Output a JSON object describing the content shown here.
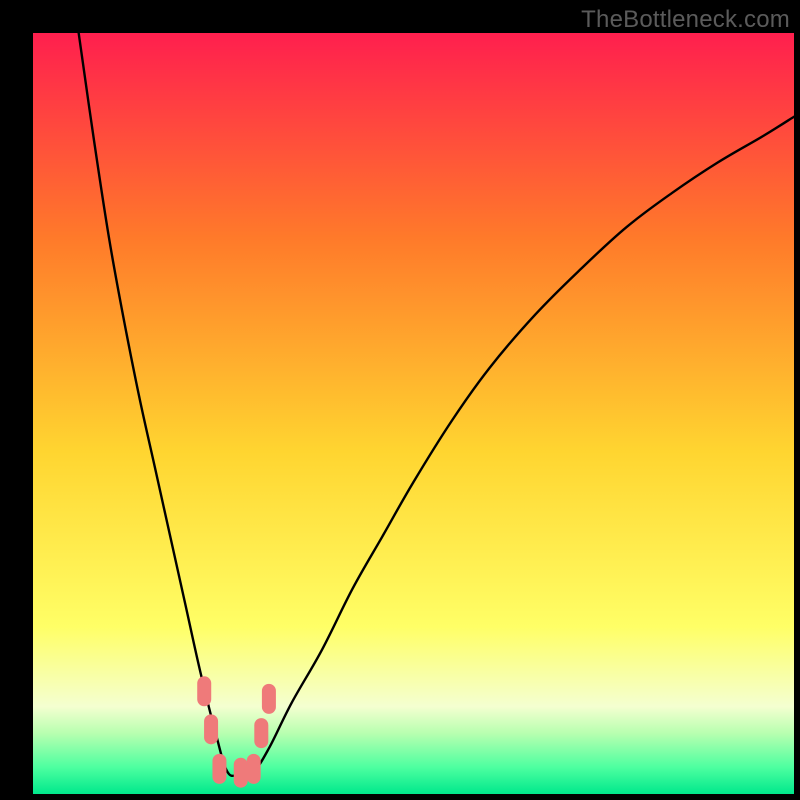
{
  "watermark": "TheBottleneck.com",
  "chart_data": {
    "type": "line",
    "title": "",
    "xlabel": "",
    "ylabel": "",
    "xlim": [
      0,
      100
    ],
    "ylim": [
      0,
      100
    ],
    "background": {
      "gradient_stops": [
        {
          "offset": 0.0,
          "color": "#ff1f4e"
        },
        {
          "offset": 0.27,
          "color": "#ff7a2a"
        },
        {
          "offset": 0.55,
          "color": "#ffd530"
        },
        {
          "offset": 0.78,
          "color": "#ffff66"
        },
        {
          "offset": 0.885,
          "color": "#f4ffd0"
        },
        {
          "offset": 0.92,
          "color": "#b8ffb0"
        },
        {
          "offset": 0.965,
          "color": "#4dffa0"
        },
        {
          "offset": 1.0,
          "color": "#00e88c"
        }
      ]
    },
    "series": [
      {
        "name": "bottleneck-curve",
        "x": [
          6,
          8,
          10,
          12,
          14,
          16,
          18,
          20,
          22,
          24,
          25.5,
          27,
          29,
          31,
          34,
          38,
          42,
          46,
          50,
          55,
          60,
          66,
          72,
          78,
          84,
          90,
          96,
          100
        ],
        "y": [
          100,
          86,
          73,
          62,
          52,
          43,
          34,
          25,
          16,
          8,
          3,
          2.5,
          3,
          6,
          12,
          19,
          27,
          34,
          41,
          49,
          56,
          63,
          69,
          74.5,
          79,
          83,
          86.5,
          89
        ]
      }
    ],
    "markers": {
      "name": "highlight-dots",
      "color": "#ef7a7a",
      "points": [
        {
          "x": 22.5,
          "y": 13.5
        },
        {
          "x": 23.4,
          "y": 8.5
        },
        {
          "x": 24.5,
          "y": 3.3
        },
        {
          "x": 27.3,
          "y": 2.8
        },
        {
          "x": 29.0,
          "y": 3.3
        },
        {
          "x": 30.0,
          "y": 8.0
        },
        {
          "x": 31.0,
          "y": 12.5
        }
      ]
    }
  }
}
